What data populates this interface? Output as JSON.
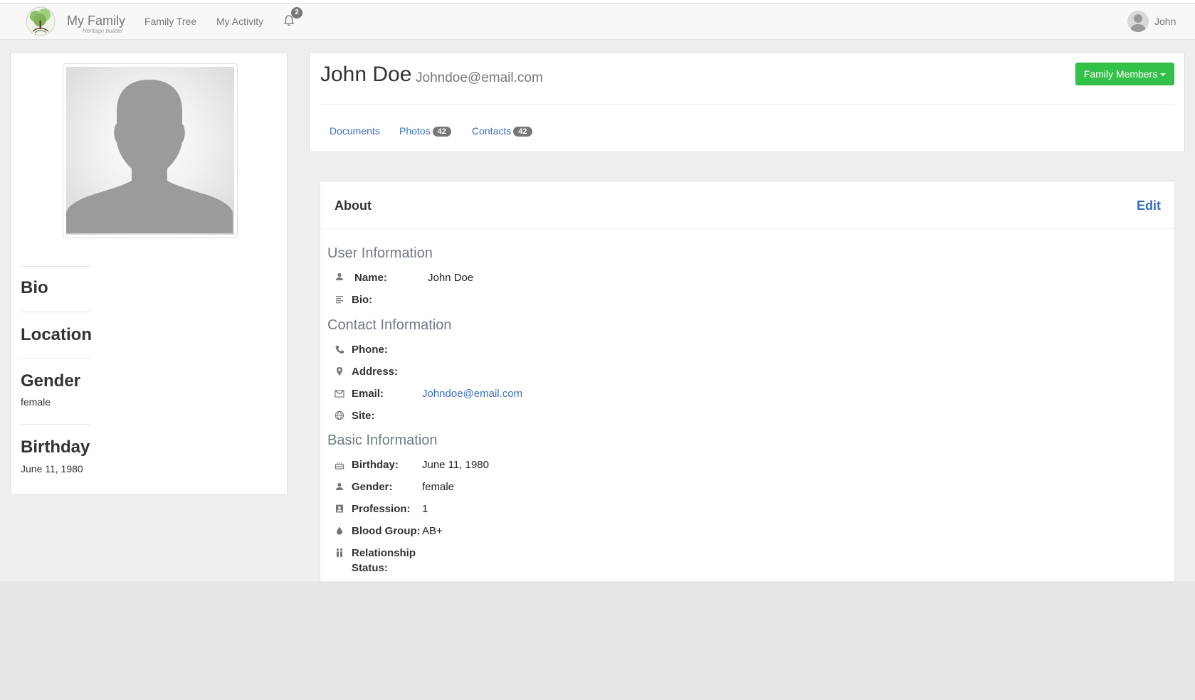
{
  "navbar": {
    "brand_title": "My Family",
    "brand_subtitle": "Heritage builder",
    "links": [
      "Family Tree",
      "My Activity"
    ],
    "notification_count": "2",
    "user_name": "John"
  },
  "sidebar": {
    "bio_heading": "Bio",
    "location_heading": "Location",
    "gender_heading": "Gender",
    "gender_value": "female",
    "birthday_heading": "Birthday",
    "birthday_value": "June 11, 1980"
  },
  "profile": {
    "name": "John Doe",
    "email": "Johndoe@email.com",
    "family_button": "Family Members",
    "tabs": [
      {
        "label": "Documents",
        "count": ""
      },
      {
        "label": "Photos",
        "count": "42"
      },
      {
        "label": "Contacts",
        "count": "42"
      }
    ]
  },
  "about": {
    "title": "About",
    "edit_label": "Edit",
    "user_info": {
      "title": "User Information",
      "name_label": "Name:",
      "name_value": "John Doe",
      "bio_label": "Bio:"
    },
    "contact_info": {
      "title": "Contact Information",
      "phone_label": "Phone:",
      "address_label": "Address:",
      "email_label": "Email:",
      "email_value": "Johndoe@email.com",
      "site_label": "Site:"
    },
    "basic_info": {
      "title": "Basic Information",
      "birthday_label": "Birthday:",
      "birthday_value": "June 11, 1980",
      "gender_label": "Gender:",
      "gender_value": "female",
      "profession_label": "Profession:",
      "profession_value": "1",
      "blood_label": "Blood Group:",
      "blood_value": "AB+",
      "relationship_label_1": "Relationship",
      "relationship_label_2": "Status:"
    }
  },
  "colors": {
    "accent": "#3a6fc2",
    "button_green": "#33c14a",
    "badge_grey": "#777777"
  }
}
